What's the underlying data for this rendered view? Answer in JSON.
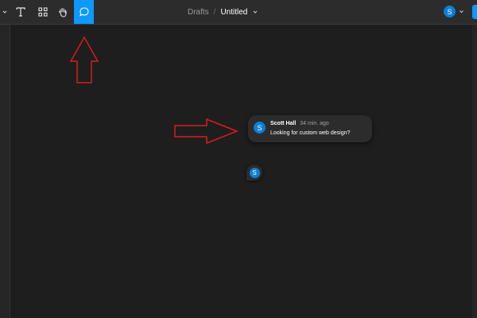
{
  "toolbar": {
    "tools": [
      {
        "name": "text-tool",
        "icon": "text-icon"
      },
      {
        "name": "resources-tool",
        "icon": "resources-icon"
      },
      {
        "name": "hand-tool",
        "icon": "hand-icon"
      },
      {
        "name": "comment-tool",
        "icon": "comment-icon",
        "active": true
      }
    ],
    "breadcrumb": {
      "parent": "Drafts",
      "separator": "/",
      "current": "Untitled"
    },
    "user_initial": "S"
  },
  "comment": {
    "avatar_initial": "S",
    "author": "Scott Hall",
    "time": "34 min. ago",
    "text": "Looking for custom web design?"
  },
  "pin": {
    "avatar_initial": "S"
  },
  "colors": {
    "accent": "#0d99ff",
    "annotation_arrow": "#d91b1b",
    "canvas": "#1e1e1e",
    "toolbar": "#2c2c2c"
  }
}
